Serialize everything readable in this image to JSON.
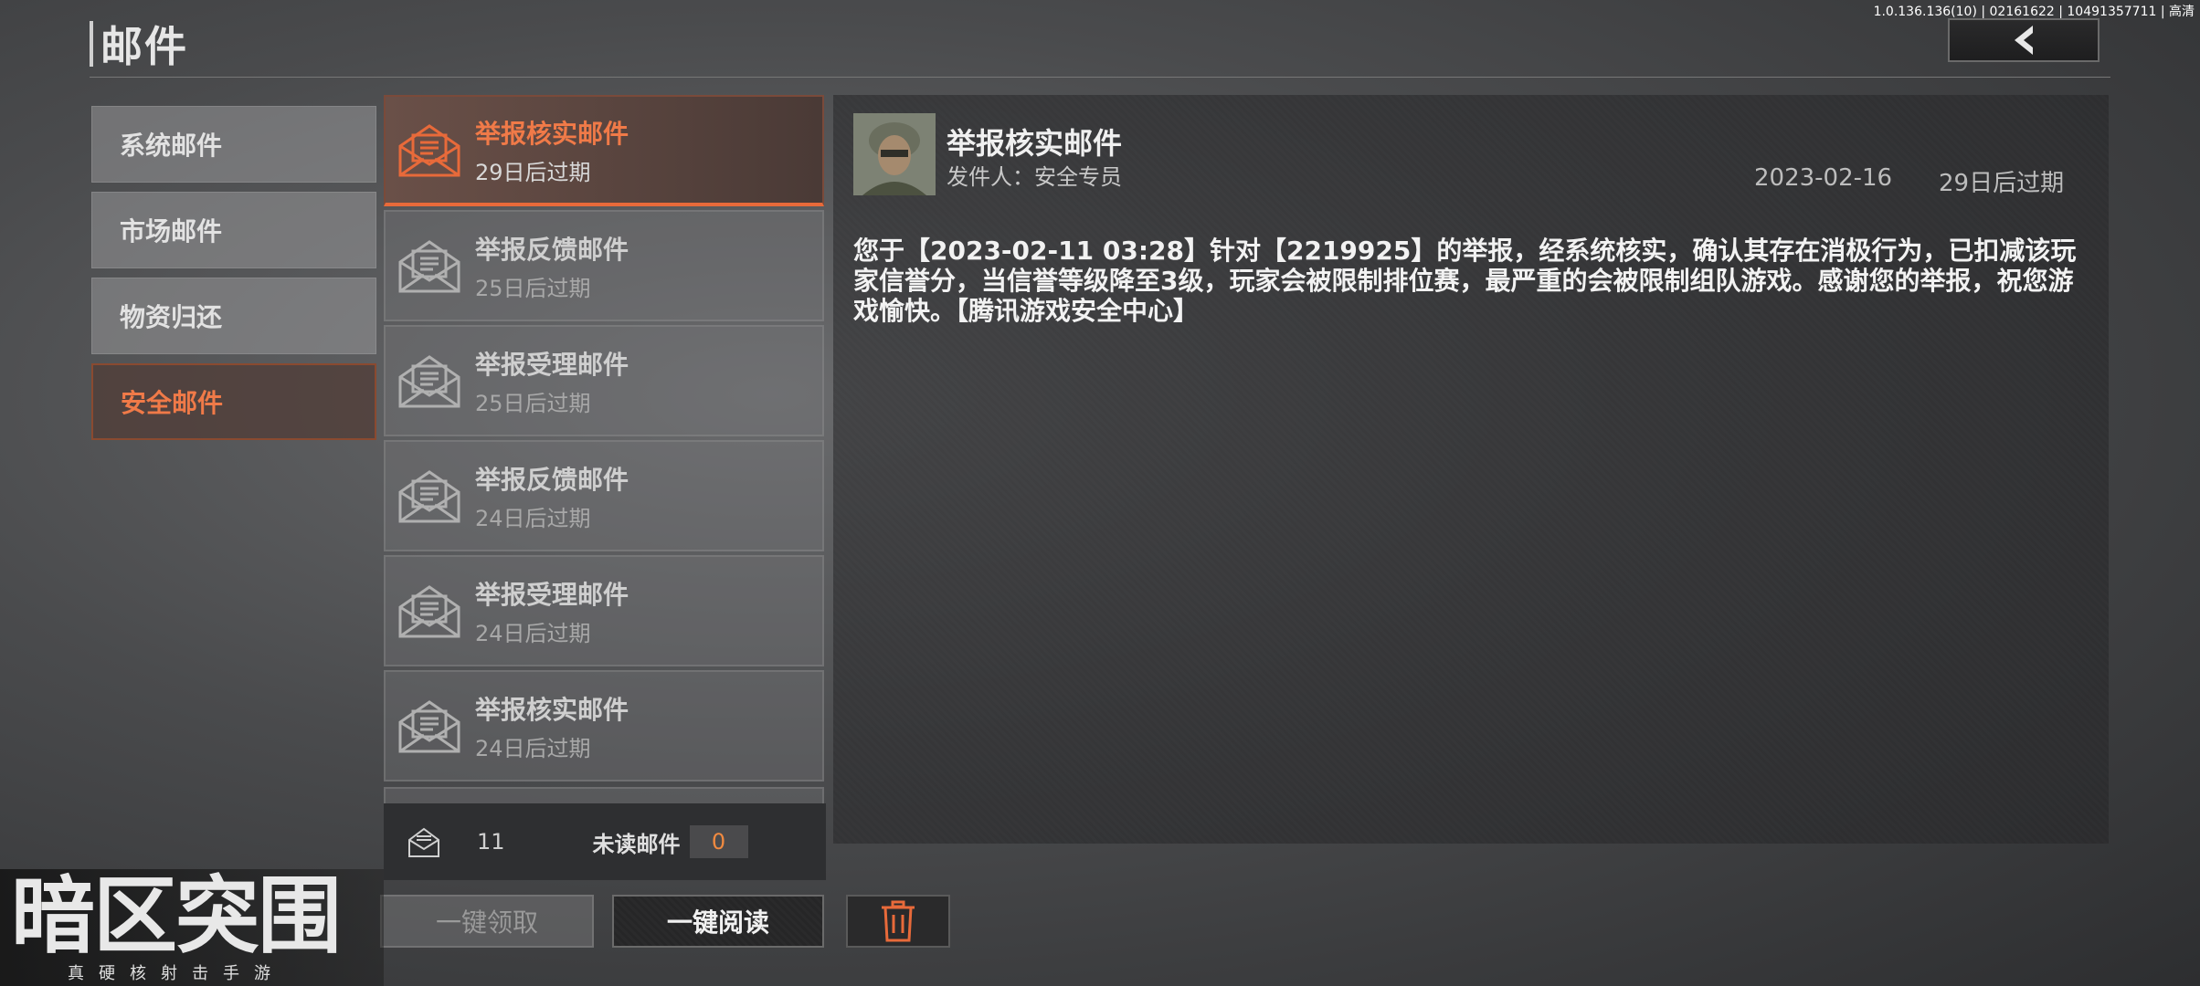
{
  "version_text": "1.0.136.136(10) | 02161622 | 10491357711 | 高清",
  "header": {
    "title": "邮件"
  },
  "categories": [
    {
      "label": "系统邮件",
      "active": false
    },
    {
      "label": "市场邮件",
      "active": false
    },
    {
      "label": "物资归还",
      "active": false
    },
    {
      "label": "安全邮件",
      "active": true
    }
  ],
  "mails": [
    {
      "title": "举报核实邮件",
      "expiry": "29日后过期",
      "active": true
    },
    {
      "title": "举报反馈邮件",
      "expiry": "25日后过期",
      "active": false
    },
    {
      "title": "举报受理邮件",
      "expiry": "25日后过期",
      "active": false
    },
    {
      "title": "举报反馈邮件",
      "expiry": "24日后过期",
      "active": false
    },
    {
      "title": "举报受理邮件",
      "expiry": "24日后过期",
      "active": false
    },
    {
      "title": "举报核实邮件",
      "expiry": "24日后过期",
      "active": false
    }
  ],
  "counts": {
    "total": "11",
    "unread_label": "未读邮件",
    "unread": "0"
  },
  "buttons": {
    "claim_all": "一键领取",
    "read_all": "一键阅读"
  },
  "detail": {
    "title": "举报核实邮件",
    "sender": "发件人：安全专员",
    "date": "2023-02-16",
    "expiry": "29日后过期",
    "body": "您于【2023-02-11 03:28】针对【2219925】的举报，经系统核实，确认其存在消极行为，已扣减该玩家信誉分，当信誉等级降至3级，玩家会被限制排位赛，最严重的会被限制组队游戏。感谢您的举报，祝您游戏愉快。【腾讯游戏安全中心】"
  },
  "logo": {
    "main": "暗区突围",
    "sub": "真硬核射击手游"
  },
  "colors": {
    "accent": "#f07a48",
    "count": "#f08a40"
  }
}
